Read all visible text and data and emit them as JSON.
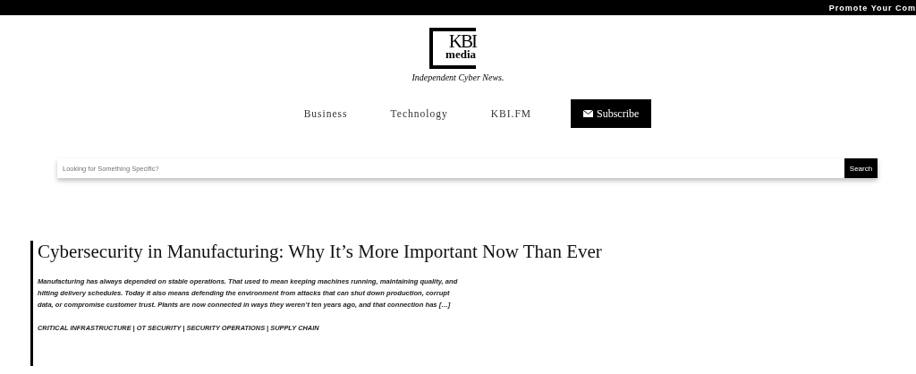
{
  "top_bar": {
    "text": "Promote Your Com"
  },
  "logo": {
    "line_1": "KBI",
    "line_2": "media",
    "tagline": "Independent Cyber News."
  },
  "nav": [
    {
      "label": "Business",
      "kind": "link"
    },
    {
      "label": "Technology",
      "kind": "link"
    },
    {
      "label": "KBI.FM",
      "kind": "link"
    },
    {
      "label": "Subscribe",
      "kind": "button"
    }
  ],
  "search": {
    "placeholder": "Looking for Something Specific?",
    "button": "Search"
  },
  "article": {
    "title": "Cybersecurity in Manufacturing: Why It’s More Important Now Than Ever",
    "excerpt": "Manufacturing has always depended on stable operations. That used to mean keeping machines running, maintaining quality, and hitting delivery schedules. Today it also means defending the environment from attacks that can shut down production, corrupt data, or compromise customer trust. Plants are now connected in ways they weren’t ten years ago, and that connection has […]",
    "tags": "CRITICAL INFRASTRUCTURE | OT SECURITY | SECURITY OPERATIONS | SUPPLY CHAIN"
  }
}
